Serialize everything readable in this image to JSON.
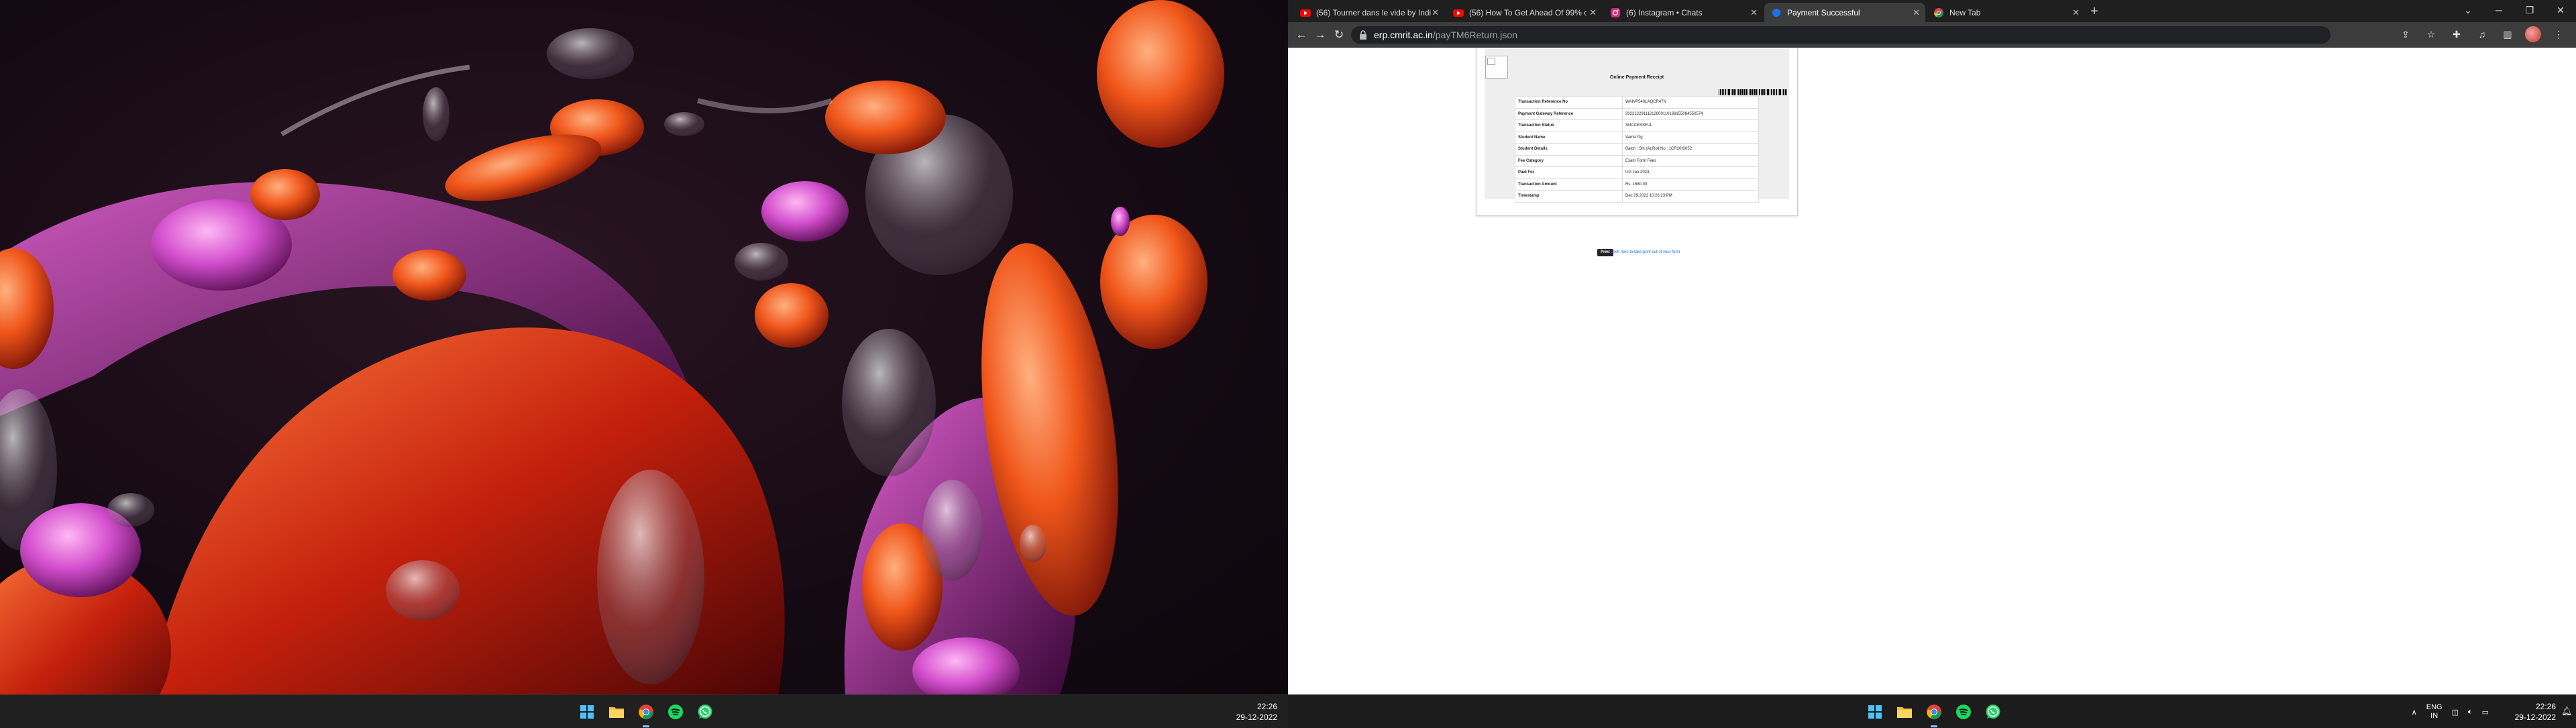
{
  "left_monitor": {
    "taskbar": {
      "apps": [
        "start-icon",
        "file-explorer-icon",
        "chrome-icon",
        "spotify-icon",
        "whatsapp-icon"
      ],
      "clock": {
        "time": "22:26",
        "date": "29-12-2022"
      }
    }
  },
  "browser": {
    "tabs": [
      {
        "title": "(56) Tourner dans le vide by Indi",
        "icon": "youtube-icon"
      },
      {
        "title": "(56) How To Get Ahead Of 99% o",
        "icon": "youtube-icon"
      },
      {
        "title": "(6) Instagram • Chats",
        "icon": "instagram-icon"
      },
      {
        "title": "Payment Successful",
        "icon": "site-icon",
        "active": true
      },
      {
        "title": "New Tab",
        "icon": "chrome-icon"
      }
    ],
    "address": {
      "host": "erp.cmrit.ac.in",
      "path": "/payTM6Return.json"
    },
    "colors": {
      "accent": "#1a73e8",
      "chrome_bg": "#3c3c3c",
      "tabstrip_bg": "#1f1f1f"
    }
  },
  "receipt": {
    "title": "Online Payment Receipt",
    "rows": [
      {
        "label": "Transaction Reference No",
        "value": "WAIVP540LAQCR47N"
      },
      {
        "label": "Payment Gateway Reference",
        "value": "20221229111212800110168155084550574"
      },
      {
        "label": "Transaction Status",
        "value": "SUCCESSFUL"
      },
      {
        "label": "Student Name",
        "value": "Vamsi Dg"
      },
      {
        "label": "Student Details",
        "value": "Batch : 5th (A) Roll No : 1CR20IS052"
      },
      {
        "label": "Fee Category",
        "value": "Exam Form Fees"
      },
      {
        "label": "Paid For",
        "value": "UG Jan 2023"
      },
      {
        "label": "Transaction Amount",
        "value": "Rs. 1680.00"
      },
      {
        "label": "Timestamp",
        "value": "Dec 29,2022 10:26:23 PM"
      }
    ],
    "print_label": "Print",
    "print_link": "Click here to take print out of your form"
  },
  "right_monitor": {
    "taskbar": {
      "apps": [
        "start-icon",
        "file-explorer-icon",
        "chrome-icon",
        "spotify-icon",
        "whatsapp-icon"
      ],
      "lang": {
        "line1": "ENG",
        "line2": "IN"
      },
      "clock": {
        "time": "22:26",
        "date": "29-12-2022"
      }
    }
  }
}
